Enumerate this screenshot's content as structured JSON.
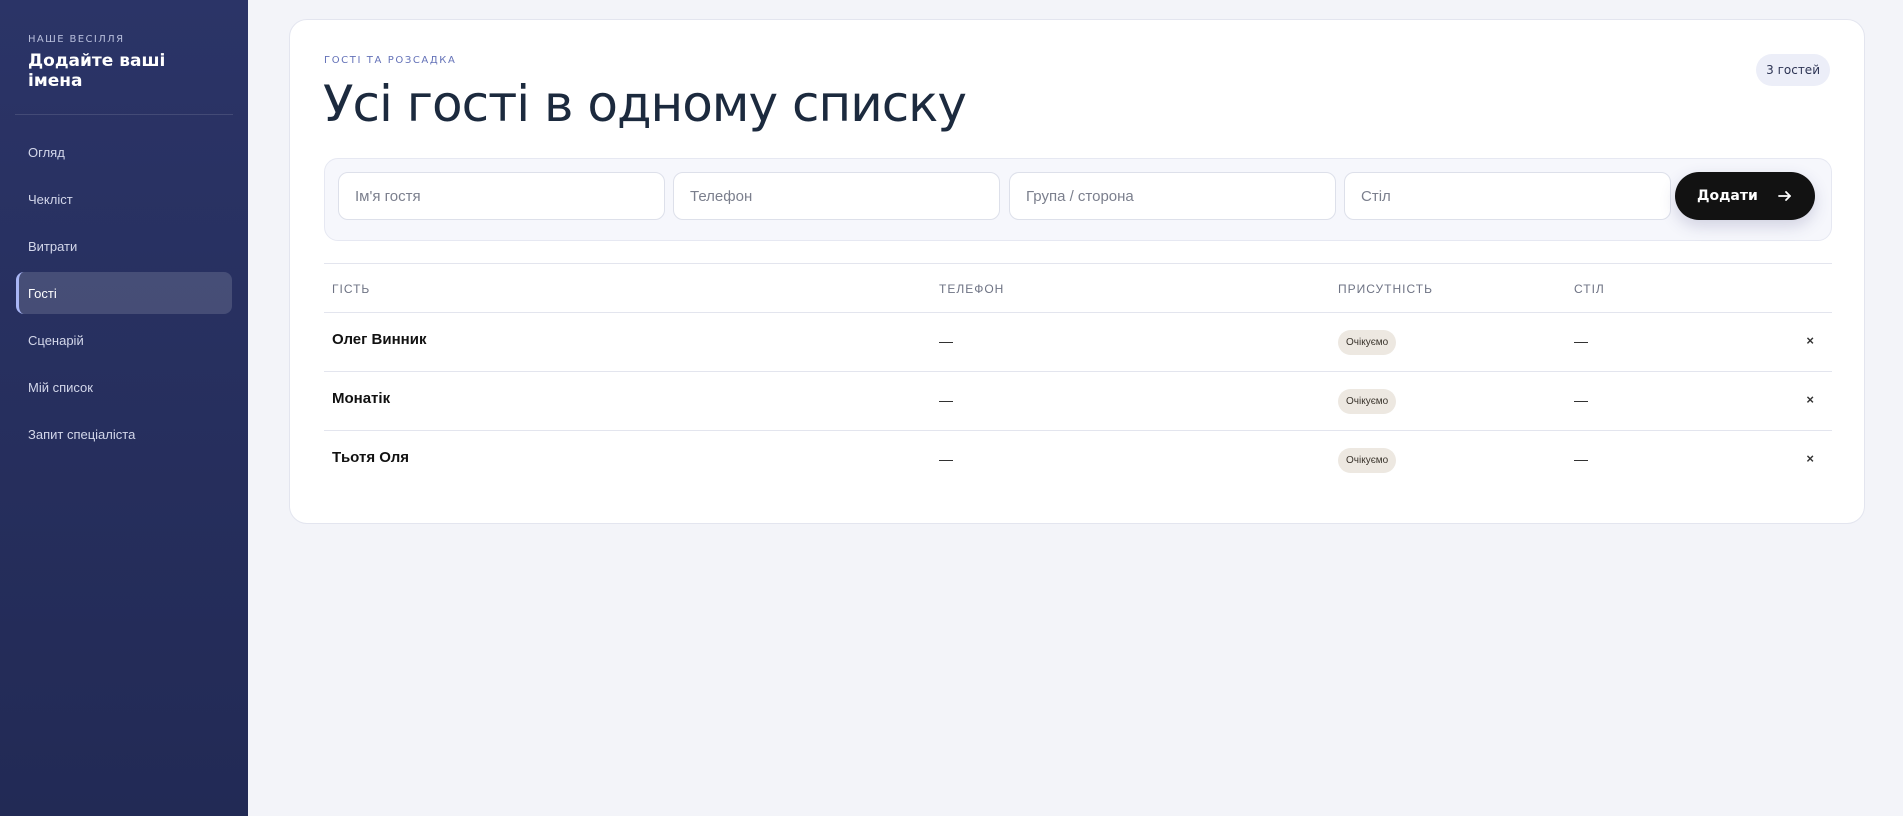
{
  "sidebar": {
    "kicker": "НАШЕ ВЕСІЛЛЯ",
    "title": "Додайте ваші імена",
    "items": [
      {
        "label": "Огляд",
        "active": false
      },
      {
        "label": "Чекліст",
        "active": false
      },
      {
        "label": "Витрати",
        "active": false
      },
      {
        "label": "Гості",
        "active": true
      },
      {
        "label": "Сценарій",
        "active": false
      },
      {
        "label": "Мій список",
        "active": false
      },
      {
        "label": "Запит спеціаліста",
        "active": false
      }
    ]
  },
  "main": {
    "kicker": "ГОСТІ ТА РОЗСАДКА",
    "title": "Усі гості в одному списку",
    "count_badge": "3 гостей",
    "form": {
      "name_placeholder": "Ім'я гостя",
      "phone_placeholder": "Телефон",
      "group_placeholder": "Група / сторона",
      "table_placeholder": "Стіл",
      "add_label": "Додати"
    },
    "table": {
      "headers": [
        "ГІСТЬ",
        "ТЕЛЕФОН",
        "ПРИСУТНІСТЬ",
        "СТІЛ"
      ],
      "rows": [
        {
          "name": "Олег Винник",
          "phone": "—",
          "status": "Очікуємо",
          "table": "—",
          "remove": "×"
        },
        {
          "name": "Монатік",
          "phone": "—",
          "status": "Очікуємо",
          "table": "—",
          "remove": "×"
        },
        {
          "name": "Тьотя Оля",
          "phone": "—",
          "status": "Очікуємо",
          "table": "—",
          "remove": "×"
        }
      ]
    }
  },
  "colors": {
    "sidebar_bg": "#2b3467",
    "accent": "#6472b8",
    "button_bg": "#121212",
    "status_bg": "#ede8e1"
  }
}
